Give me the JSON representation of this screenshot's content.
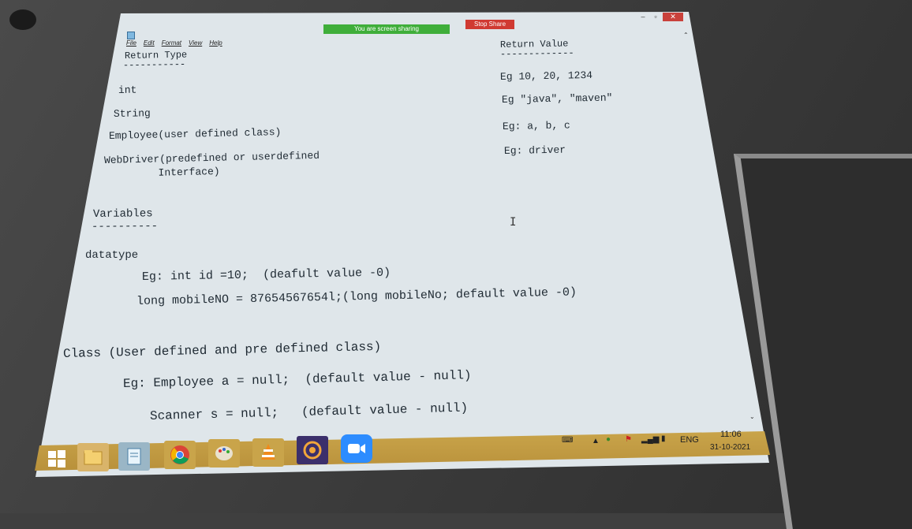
{
  "zoom_banner": {
    "sharing_text": "You are screen sharing",
    "stop_label": "Stop Share"
  },
  "window": {
    "minimize": "–",
    "maximize": "▫",
    "close": "✕"
  },
  "menu": [
    "File",
    "Edit",
    "Format",
    "View",
    "Help"
  ],
  "left_column": {
    "header": "Return Type",
    "header_rule": "-----------",
    "items": [
      "int",
      "String",
      "Employee(user defined class)",
      "WebDriver(predefined or userdefined",
      "       Interface)"
    ]
  },
  "right_column": {
    "header": "Return Value",
    "header_rule": "-------------",
    "items": [
      "Eg 10, 20, 1234",
      "Eg \"java\", \"maven\"",
      "Eg: a, b, c",
      "Eg: driver"
    ]
  },
  "variables": {
    "header": "Variables",
    "header_rule": "----------",
    "datatype": "datatype",
    "eg1": "Eg: int id =10;  (deafult value -0)",
    "eg2": "long mobileNO = 87654567654l;(long mobileNo; default value -0)",
    "class_heading": "Class (User defined and pre defined class)",
    "eg3": "Eg: Employee a = null;  (default value - null)",
    "eg4": "Scanner s = null;   (default value - null)"
  },
  "taskbar": {
    "apps": [
      "windows-start",
      "file-explorer",
      "notepad",
      "chrome",
      "paint",
      "vlc",
      "java-ee-ide",
      "zoom"
    ],
    "language": "ENG",
    "time": "11:06",
    "date": "31-10-2021"
  }
}
